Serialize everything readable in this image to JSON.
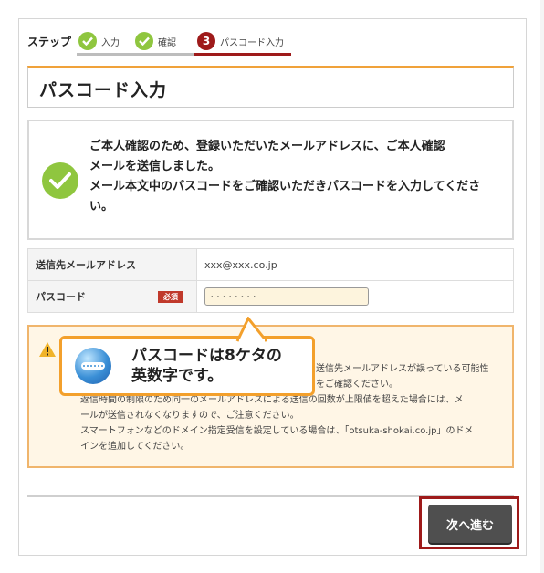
{
  "steps": {
    "label": "ステップ",
    "items": [
      {
        "num": "",
        "label": "入力"
      },
      {
        "num": "",
        "label": "確認"
      },
      {
        "num": "3",
        "label": "パスコード入力"
      }
    ]
  },
  "page_title": "パスコード入力",
  "message": {
    "line1": "ご本人確認のため、登録いただいたメールアドレスに、ご本人確認",
    "line2": "メールを送信しました。",
    "line3": "メール本文中のパスコードをご確認いただきパスコードを入力してくださ",
    "line4": "い。"
  },
  "form": {
    "email_label": "送信先メールアドレス",
    "email_value": "xxx@xxx.co.jp",
    "passcode_label": "パスコード",
    "required_badge": "必須",
    "passcode_value": "········"
  },
  "warning": {
    "line1": "送信先メールアドレスが誤っている可能性",
    "line2": "をご確認ください。",
    "line3": "返信時間の制限のため同一のメールアドレスによる送信の回数が上限値を超えた場合には、メ",
    "line4": "ールが送信されなくなりますので、ご注意ください。",
    "line5": "スマートフォンなどのドメイン指定受信を設定している場合は、「otsuka-shokai.co.jp」のドメ",
    "line6": "インを追加してください。"
  },
  "callout": {
    "line1": "パスコードは8ケタの",
    "line2": "英数字です。"
  },
  "next_button": "次へ進む"
}
